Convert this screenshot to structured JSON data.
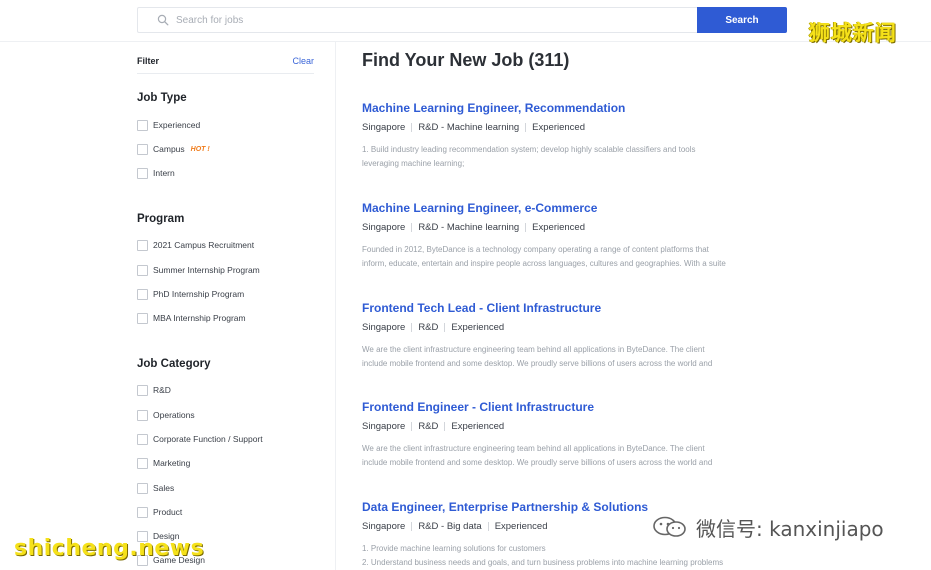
{
  "search": {
    "placeholder": "Search for jobs",
    "button_label": "Search"
  },
  "sidebar": {
    "filter_label": "Filter",
    "clear_label": "Clear",
    "groups": [
      {
        "title": "Job Type",
        "options": [
          {
            "label": "Experienced",
            "checked": false
          },
          {
            "label": "Campus",
            "checked": false,
            "badge": "HOT !"
          },
          {
            "label": "Intern",
            "checked": false
          }
        ]
      },
      {
        "title": "Program",
        "options": [
          {
            "label": "2021 Campus Recruitment",
            "checked": false
          },
          {
            "label": "Summer Internship Program",
            "checked": false
          },
          {
            "label": "PhD Internship Program",
            "checked": false
          },
          {
            "label": "MBA Internship Program",
            "checked": false
          }
        ]
      },
      {
        "title": "Job Category",
        "options": [
          {
            "label": "R&D",
            "checked": false
          },
          {
            "label": "Operations",
            "checked": false
          },
          {
            "label": "Corporate Function / Support",
            "checked": false
          },
          {
            "label": "Marketing",
            "checked": false
          },
          {
            "label": "Sales",
            "checked": false
          },
          {
            "label": "Product",
            "checked": false
          },
          {
            "label": "Design",
            "checked": false
          },
          {
            "label": "Game Design",
            "checked": false
          }
        ]
      }
    ]
  },
  "main": {
    "title": "Find Your New Job (311)",
    "jobs": [
      {
        "title": "Machine Learning Engineer, Recommendation",
        "location": "Singapore",
        "category": "R&D - Machine learning",
        "type": "Experienced",
        "desc_lines": [
          "1. Build industry leading recommendation system; develop highly scalable classifiers and tools",
          "leveraging machine learning;"
        ]
      },
      {
        "title": "Machine Learning Engineer, e-Commerce",
        "location": "Singapore",
        "category": "R&D - Machine learning",
        "type": "Experienced",
        "desc_lines": [
          "Founded in 2012, ByteDance is a technology company operating a range of content platforms that",
          "inform, educate, entertain and inspire people across languages, cultures and geographies. With a suite"
        ]
      },
      {
        "title": "Frontend Tech Lead - Client Infrastructure",
        "location": "Singapore",
        "category": "R&D",
        "type": "Experienced",
        "desc_lines": [
          "We are the client infrastructure engineering team behind all applications in ByteDance. The client",
          "include mobile frontend and some desktop. We proudly serve billions of users across the world and"
        ]
      },
      {
        "title": "Frontend Engineer - Client Infrastructure",
        "location": "Singapore",
        "category": "R&D",
        "type": "Experienced",
        "desc_lines": [
          "We are the client infrastructure engineering team behind all applications in ByteDance. The client",
          "include mobile frontend and some desktop. We proudly serve billions of users across the world and"
        ]
      },
      {
        "title": "Data Engineer, Enterprise Partnership & Solutions",
        "location": "Singapore",
        "category": "R&D - Big data",
        "type": "Experienced",
        "desc_lines": [
          "1. Provide machine learning solutions for customers",
          "2. Understand business needs and goals, and turn business problems into machine learning problems"
        ]
      }
    ]
  },
  "watermarks": {
    "top_right": "狮城新闻",
    "bottom_left": "shicheng.news",
    "wechat": "微信号: kanxinjiapo"
  },
  "colors": {
    "accent": "#2f5bd4",
    "hot_badge": "#f07c1b",
    "watermark": "#f5e11a"
  }
}
